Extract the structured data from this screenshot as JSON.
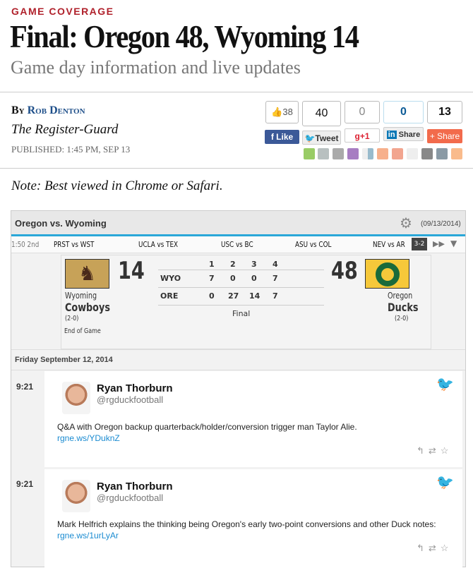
{
  "kicker": "GAME COVERAGE",
  "title": "Final: Oregon 48, Wyoming 14",
  "subtitle": "Game day information and live updates",
  "byline": {
    "by": "By",
    "author": "Rob Denton",
    "org": "The Register-Guard",
    "published": "PUBLISHED: 1:45 PM, SEP 13"
  },
  "share": {
    "facebook": {
      "count": "38",
      "label": "Like"
    },
    "twitter": {
      "count": "40",
      "label": "Tweet"
    },
    "gplus": {
      "count": "0",
      "label": "+1"
    },
    "linkedin": {
      "count": "0",
      "label": "Share"
    },
    "addthis": {
      "count": "13",
      "label": "Share"
    },
    "icons": [
      "print",
      "email",
      "gmail",
      "yahoo",
      "delicious",
      "bebo",
      "stumbleupon",
      "reddit",
      "digg",
      "tumblr",
      "blogger"
    ]
  },
  "note": "Note: Best viewed in Chrome or Safari.",
  "widget": {
    "title": "Oregon vs. Wyoming",
    "date": "(09/13/2014)",
    "ticker": {
      "status": "1:50 2nd",
      "games": [
        "PRST vs WST",
        "UCLA vs TEX",
        "USC vs BC",
        "ASU vs COL",
        "NEV vs AR"
      ],
      "badge": "3-2"
    },
    "score": {
      "away": {
        "city": "Wyoming",
        "name": "Cowboys",
        "record": "(2-0)",
        "score": "14",
        "abbr": "WYO",
        "quarters": [
          "7",
          "0",
          "0",
          "7"
        ]
      },
      "home": {
        "city": "Oregon",
        "name": "Ducks",
        "record": "(2-0)",
        "score": "48",
        "abbr": "ORE",
        "quarters": [
          "0",
          "27",
          "14",
          "7"
        ]
      },
      "periods": [
        "1",
        "2",
        "3",
        "4"
      ],
      "status": "Final",
      "detail": "End of Game"
    },
    "day": "Friday September 12, 2014",
    "tweets": [
      {
        "time": "9:21",
        "name": "Ryan Thorburn",
        "handle": "@rgduckfootball",
        "text": "Q&A with Oregon backup quarterback/holder/conversion trigger man Taylor Alie.",
        "link": "rgne.ws/YDuknZ"
      },
      {
        "time": "9:21",
        "name": "Ryan Thorburn",
        "handle": "@rgduckfootball",
        "text": "Mark Helfrich explains the thinking being Oregon's early two-point conversions and other Duck notes:",
        "link": "rgne.ws/1urLyAr"
      }
    ]
  },
  "colors": {
    "kicker": "#b0212b",
    "author": "#1d4e89",
    "twitter": "#2aa7e2",
    "accent": "#2aa7d8"
  }
}
